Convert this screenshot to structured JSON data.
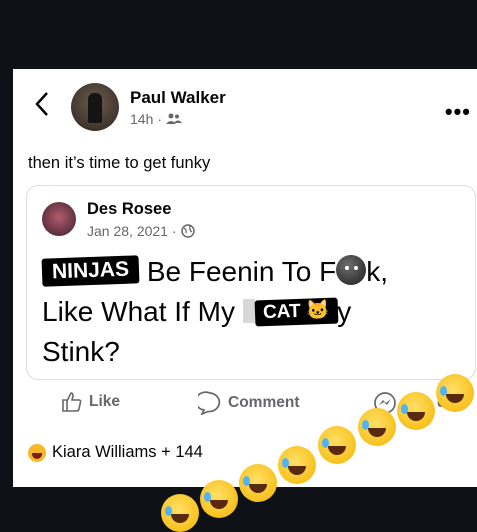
{
  "post": {
    "author": "Paul Walker",
    "time": "14h",
    "text": "then it’s time to get funky"
  },
  "shared": {
    "author": "Des Rosee",
    "date": "Jan 28, 2021",
    "sticker_ninjas": "NINJAS",
    "line1_text": "Be Feenin To F",
    "line1_tail": "k,",
    "line2_text": "Like What If My",
    "sticker_cat": "CAT 🐱",
    "line2_tail": "y",
    "line3_text": "Stink?"
  },
  "actions": {
    "like": "Like",
    "comment": "Comment",
    "share": "d"
  },
  "reactions": {
    "summary": "Kiara Williams + 144"
  },
  "icons": [
    "back-icon",
    "friends-icon",
    "more-icon",
    "globe-icon",
    "like-icon",
    "comment-icon",
    "messenger-icon",
    "haha-icon",
    "rofl-emoji"
  ]
}
